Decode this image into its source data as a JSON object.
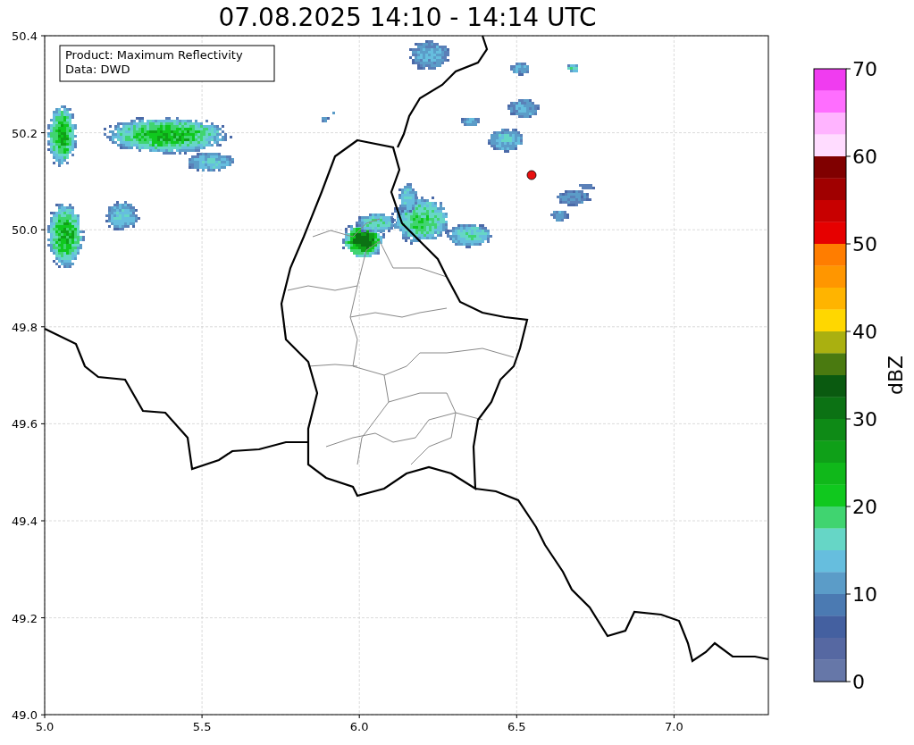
{
  "title": "07.08.2025 14:10 - 14:14 UTC",
  "info_box": [
    "Product: Maximum Reflectivity",
    "Data: DWD"
  ],
  "map": {
    "x_ticks": [
      "5.0",
      "5.5",
      "6.0",
      "6.5",
      "7.0"
    ],
    "y_ticks": [
      "50.4",
      "50.2",
      "50.0",
      "49.8",
      "49.6",
      "49.4",
      "49.2",
      "49.0"
    ]
  },
  "colorbar": {
    "label": "dBZ",
    "ticks": [
      "70",
      "60",
      "50",
      "40",
      "30",
      "20",
      "10",
      "0"
    ],
    "bands": [
      {
        "color": "#f03cf0"
      },
      {
        "color": "#ff6eff"
      },
      {
        "color": "#ffb4ff"
      },
      {
        "color": "#ffdcff"
      },
      {
        "color": "#800000"
      },
      {
        "color": "#a00000"
      },
      {
        "color": "#c80000"
      },
      {
        "color": "#e60000"
      },
      {
        "color": "#ff7d00"
      },
      {
        "color": "#ff9600"
      },
      {
        "color": "#ffb400"
      },
      {
        "color": "#ffd700"
      },
      {
        "color": "#aab010"
      },
      {
        "color": "#4a7a10"
      },
      {
        "color": "#0a5a10"
      },
      {
        "color": "#0c7214"
      },
      {
        "color": "#0e8a16"
      },
      {
        "color": "#0fa018"
      },
      {
        "color": "#10b81a"
      },
      {
        "color": "#10c81e"
      },
      {
        "color": "#40d470"
      },
      {
        "color": "#66d6c6"
      },
      {
        "color": "#66bede"
      },
      {
        "color": "#5b9cc8"
      },
      {
        "color": "#4b7ab2"
      },
      {
        "color": "#4460a0"
      },
      {
        "color": "#5668a2"
      },
      {
        "color": "#6677a8"
      }
    ]
  }
}
